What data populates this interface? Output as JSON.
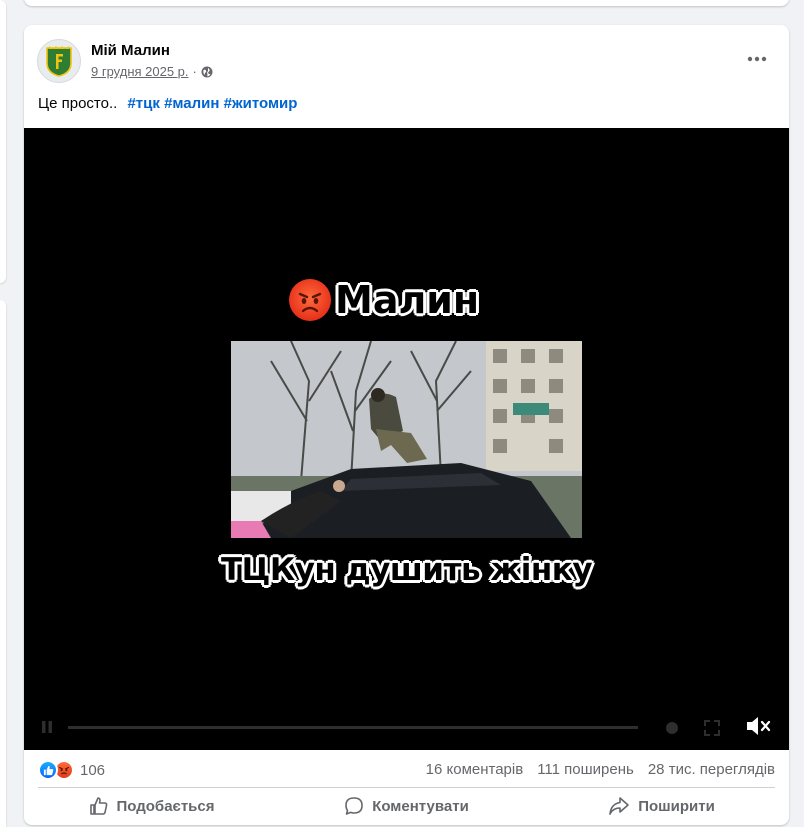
{
  "post": {
    "author": "Мій Малин",
    "date": "9 грудня 2025 р.",
    "separator": "·",
    "text": "Це просто..",
    "hashtags": [
      "#тцк",
      "#малин",
      "#житомир"
    ],
    "privacy_icon": "globe-icon"
  },
  "video": {
    "title_emoji": "angry-face-emoji",
    "title": "Малин",
    "caption": "ТЦКун душить жінку"
  },
  "stats": {
    "reaction_icons": [
      "like-icon",
      "angry-icon"
    ],
    "reaction_count": "106",
    "comments": "16 коментарів",
    "shares": "111 поширень",
    "views": "28 тис. переглядів"
  },
  "actions": {
    "like": "Подобається",
    "comment": "Коментувати",
    "share": "Поширити"
  },
  "colors": {
    "accent": "#0064d1",
    "muted": "#65676b",
    "background": "#f0f2f5"
  }
}
